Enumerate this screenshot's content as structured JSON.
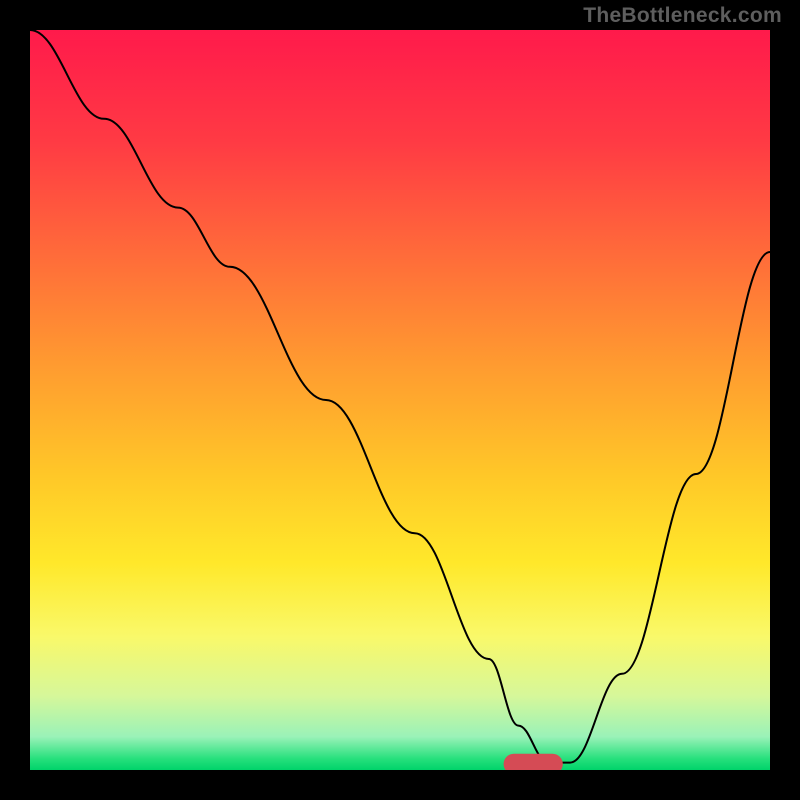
{
  "watermark": "TheBottleneck.com",
  "chart_data": {
    "type": "line",
    "title": "",
    "xlabel": "",
    "ylabel": "",
    "xlim": [
      0,
      100
    ],
    "ylim": [
      0,
      100
    ],
    "background": {
      "type": "vertical-gradient",
      "stops": [
        {
          "offset": 0.0,
          "color": "#ff1a4b"
        },
        {
          "offset": 0.15,
          "color": "#ff3a44"
        },
        {
          "offset": 0.3,
          "color": "#ff6a3a"
        },
        {
          "offset": 0.45,
          "color": "#ff9a30"
        },
        {
          "offset": 0.6,
          "color": "#ffc728"
        },
        {
          "offset": 0.72,
          "color": "#ffe82a"
        },
        {
          "offset": 0.82,
          "color": "#f9f96a"
        },
        {
          "offset": 0.9,
          "color": "#d6f79a"
        },
        {
          "offset": 0.955,
          "color": "#9af2b8"
        },
        {
          "offset": 0.985,
          "color": "#26e07c"
        },
        {
          "offset": 1.0,
          "color": "#00d36a"
        }
      ]
    },
    "series": [
      {
        "name": "bottleneck-curve",
        "color": "#000000",
        "x": [
          0,
          10,
          20,
          27,
          40,
          52,
          62,
          66,
          70,
          73,
          80,
          90,
          100
        ],
        "values": [
          100,
          88,
          76,
          68,
          50,
          32,
          15,
          6,
          1,
          1,
          13,
          40,
          70
        ]
      }
    ],
    "marker": {
      "name": "optimal-range",
      "color": "#d54b55",
      "x_start": 64,
      "x_end": 72,
      "y": 0.8,
      "thickness": 2.8
    }
  }
}
